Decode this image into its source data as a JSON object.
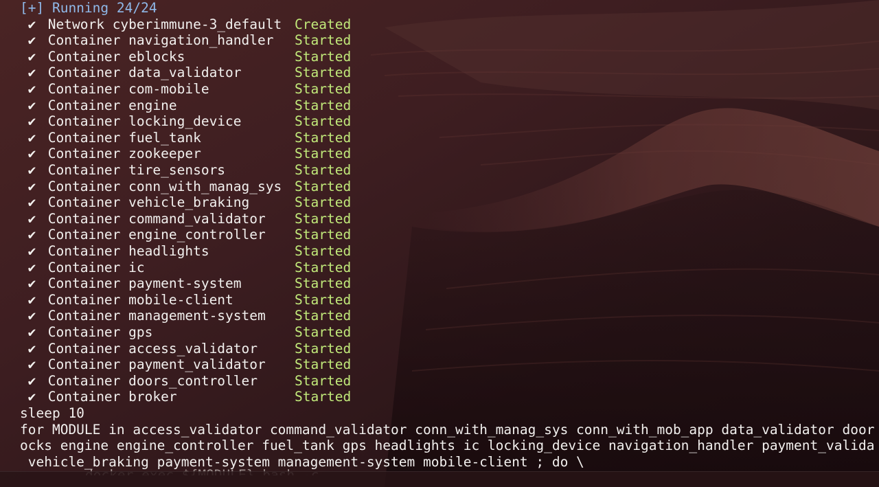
{
  "terminal": {
    "header": "[+] Running 24/24",
    "check_glyph": "✔",
    "items": [
      {
        "kind": "Network",
        "name": "cyberimmune-3_default",
        "status": "Created"
      },
      {
        "kind": "Container",
        "name": "navigation_handler",
        "status": "Started"
      },
      {
        "kind": "Container",
        "name": "eblocks",
        "status": "Started"
      },
      {
        "kind": "Container",
        "name": "data_validator",
        "status": "Started"
      },
      {
        "kind": "Container",
        "name": "com-mobile",
        "status": "Started"
      },
      {
        "kind": "Container",
        "name": "engine",
        "status": "Started"
      },
      {
        "kind": "Container",
        "name": "locking_device",
        "status": "Started"
      },
      {
        "kind": "Container",
        "name": "fuel_tank",
        "status": "Started"
      },
      {
        "kind": "Container",
        "name": "zookeeper",
        "status": "Started"
      },
      {
        "kind": "Container",
        "name": "tire_sensors",
        "status": "Started"
      },
      {
        "kind": "Container",
        "name": "conn_with_manag_sys",
        "status": "Started"
      },
      {
        "kind": "Container",
        "name": "vehicle_braking",
        "status": "Started"
      },
      {
        "kind": "Container",
        "name": "command_validator",
        "status": "Started"
      },
      {
        "kind": "Container",
        "name": "engine_controller",
        "status": "Started"
      },
      {
        "kind": "Container",
        "name": "headlights",
        "status": "Started"
      },
      {
        "kind": "Container",
        "name": "ic",
        "status": "Started"
      },
      {
        "kind": "Container",
        "name": "payment-system",
        "status": "Started"
      },
      {
        "kind": "Container",
        "name": "mobile-client",
        "status": "Started"
      },
      {
        "kind": "Container",
        "name": "management-system",
        "status": "Started"
      },
      {
        "kind": "Container",
        "name": "gps",
        "status": "Started"
      },
      {
        "kind": "Container",
        "name": "access_validator",
        "status": "Started"
      },
      {
        "kind": "Container",
        "name": "payment_validator",
        "status": "Started"
      },
      {
        "kind": "Container",
        "name": "doors_controller",
        "status": "Started"
      },
      {
        "kind": "Container",
        "name": "broker",
        "status": "Started"
      }
    ],
    "commands": [
      "sleep 10",
      "for MODULE in access_validator command_validator conn_with_manag_sys conn_with_mob_app data_validator door",
      "ocks engine engine_controller fuel_tank gps headlights ic locking_device navigation_handler payment_valida",
      " vehicle_braking payment-system management-system mobile-client ; do \\"
    ],
    "partial_line": "        docker exec ${MODULE} bash -c"
  },
  "colors": {
    "header": "#8fb8e8",
    "status": "#c1e97a",
    "text": "#f2f0ee",
    "background": "#33191b"
  }
}
